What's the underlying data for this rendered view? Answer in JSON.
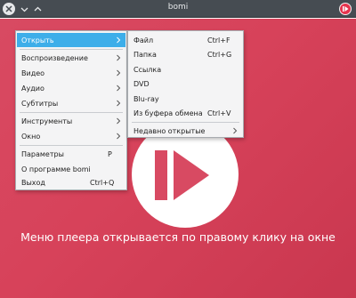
{
  "window": {
    "title": "bomi"
  },
  "hint_text": "Меню плеера открывается по правому клику на окне",
  "colors": {
    "background": "#d84a62",
    "highlight": "#3daee9",
    "titlebar": "#464c52"
  },
  "main_menu": {
    "items": [
      {
        "label": "Открыть",
        "has_submenu": true,
        "active": true
      },
      {
        "label": "Воспроизведение",
        "has_submenu": true
      },
      {
        "label": "Видео",
        "has_submenu": true
      },
      {
        "label": "Аудио",
        "has_submenu": true
      },
      {
        "label": "Субтитры",
        "has_submenu": true
      },
      {
        "label": "Инструменты",
        "has_submenu": true
      },
      {
        "label": "Окно",
        "has_submenu": true
      },
      {
        "label": "Параметры",
        "shortcut": "P"
      },
      {
        "label": "О программе bomi"
      },
      {
        "label": "Выход",
        "shortcut": "Ctrl+Q"
      }
    ]
  },
  "open_submenu": {
    "items": [
      {
        "label": "Файл",
        "shortcut": "Ctrl+F"
      },
      {
        "label": "Папка",
        "shortcut": "Ctrl+G"
      },
      {
        "label": "Ссылка"
      },
      {
        "label": "DVD"
      },
      {
        "label": "Blu-ray"
      },
      {
        "label": "Из буфера обмена",
        "shortcut": "Ctrl+V"
      },
      {
        "label": "Недавно открытые",
        "has_submenu": true
      }
    ]
  }
}
